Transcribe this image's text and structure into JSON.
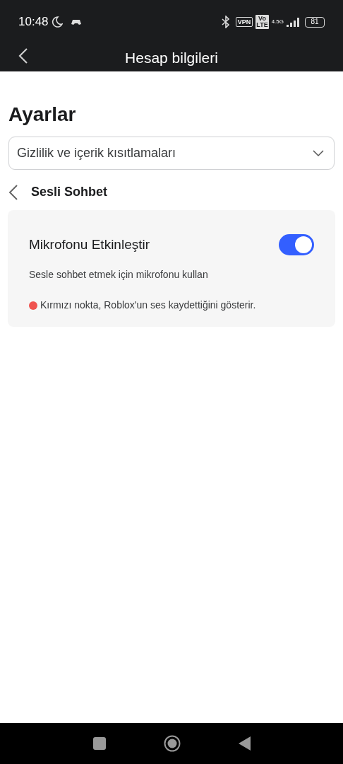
{
  "status_bar": {
    "time": "10:48",
    "vpn": "VPN",
    "volte": [
      "Vo",
      "LTE"
    ],
    "network": "4.5G",
    "battery": "81"
  },
  "header": {
    "title": "Hesap bilgileri"
  },
  "page_title": "Ayarlar",
  "category_select": {
    "value": "Gizlilik ve içerik kısıtlamaları"
  },
  "section": {
    "title": "Sesli Sohbet"
  },
  "setting": {
    "label": "Mikrofonu Etkinleştir",
    "on": true,
    "description": "Sesle sohbet etmek için mikrofonu kullan",
    "note": "Kırmızı nokta, Roblox'un ses kaydettiğini gösterir.",
    "note_dot": {
      "color": "#ef5350"
    }
  }
}
